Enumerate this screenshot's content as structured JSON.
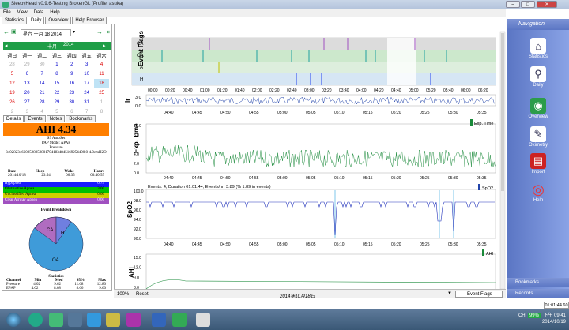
{
  "window": {
    "title": "SleepyHead v0.9.6-Testing BrokenGL (Profile: asuka)"
  },
  "menu": [
    "File",
    "View",
    "Data",
    "Help"
  ],
  "main_tabs": [
    "Statistics",
    "Daily",
    "Overview",
    "Help Browser"
  ],
  "date_nav": {
    "date": "星六 十月 18 2014"
  },
  "calendar": {
    "month": "十月",
    "year": "2014",
    "weekdays": [
      "週日",
      "週一",
      "週二",
      "週三",
      "週四",
      "週五",
      "週六"
    ],
    "weeks": [
      [
        "28",
        "29",
        "30",
        "1",
        "2",
        "3",
        "4"
      ],
      [
        "5",
        "6",
        "7",
        "8",
        "9",
        "10",
        "11"
      ],
      [
        "12",
        "13",
        "14",
        "15",
        "16",
        "17",
        "18"
      ],
      [
        "19",
        "20",
        "21",
        "22",
        "23",
        "24",
        "25"
      ],
      [
        "26",
        "27",
        "28",
        "29",
        "30",
        "31",
        "1"
      ],
      [
        "2",
        "3",
        "4",
        "5",
        "6",
        "7",
        "8"
      ]
    ]
  },
  "detail_tabs": [
    "Details",
    "Events",
    "Notes",
    "Bookmarks"
  ],
  "ahi": {
    "label": "AHI 4.34"
  },
  "machine": {
    "name": "S9 AutoSet",
    "mode": "PAP Mode: APAP",
    "pressure_label": "Pressure",
    "serial": "3402823466085288598017041834845169254400.0-4.0cmH2O"
  },
  "summary": {
    "headers": [
      "Date",
      "Sleep",
      "Wake",
      "Hours"
    ],
    "values": [
      "2014/10/18",
      "23:54",
      "06:35",
      "06:40:55"
    ]
  },
  "events": [
    {
      "name": "Hypopnea",
      "value": "0.75",
      "color": "#1a1aff"
    },
    {
      "name": "Obstructive Apnea",
      "value": "3.00",
      "color": "#00c000"
    },
    {
      "name": "Unclassified Apnea",
      "value": "0.60",
      "color": "#d0d000"
    },
    {
      "name": "Clear Airway Apnea",
      "value": "0.00",
      "color": "#a050c0"
    }
  ],
  "breakdown": {
    "title": "Event Breakdown",
    "labels": [
      "CA",
      "H",
      "OA"
    ]
  },
  "stats": {
    "title": "Statistics",
    "headers": [
      "Channel",
      "Min",
      "Med",
      "95%",
      "Max"
    ],
    "rows": [
      [
        "Pressure",
        "4.02",
        "9.62",
        "11.68",
        "12.80"
      ],
      [
        "EPAP",
        "4.02",
        "8.68",
        "8.66",
        "9.60"
      ]
    ]
  },
  "graphs": {
    "event_flags": {
      "ylabel": "Event Flags",
      "rows": [
        "CA",
        "OA",
        "A",
        "H"
      ],
      "times": [
        "00:00",
        "00:20",
        "00:40",
        "01:00",
        "01:20",
        "01:40",
        "02:00",
        "02:20",
        "02:40",
        "03:00",
        "03:20",
        "03:40",
        "04:00",
        "04:20",
        "04:40",
        "05:00",
        "05:20",
        "05:40",
        "06:00",
        "06:20"
      ]
    },
    "insp": {
      "ylabel": "Ir",
      "ticks": [
        "3.0",
        "0.0"
      ]
    },
    "time_ticks": [
      "04:40",
      "04:45",
      "04:50",
      "04:55",
      "05:00",
      "05:05",
      "05:10",
      "05:15",
      "05:20",
      "05:25",
      "05:30",
      "05:35"
    ],
    "exp_time": {
      "ylabel": "Exp. Time",
      "ticks": [
        "10.0",
        "8.0",
        "6.0",
        "4.0",
        "2.0",
        "0.0"
      ],
      "legend": "Exp. Time"
    },
    "spo2": {
      "ylabel": "SpO2",
      "ticks": [
        "100.0",
        "98.0",
        "96.0",
        "94.0",
        "92.0",
        "90.0"
      ],
      "info": "Events: 4, Duration 01:01:44, Events/hr: 3.89 (% 1.89 in events)",
      "legend": "SpO2"
    },
    "ahi": {
      "ylabel": "AHI",
      "ticks": [
        "15.0",
        "12.0",
        "9.0",
        "8.0"
      ],
      "legend": "AHI"
    }
  },
  "bottom": {
    "zoom": "100%",
    "reset": "Reset",
    "date": "2014年10月18日",
    "dropdown": "Event Flags"
  },
  "nav": {
    "title": "Navigation",
    "items": [
      "Statistics",
      "Daily",
      "Overview",
      "Oximetry",
      "Import",
      "Help"
    ],
    "bookmarks": "Bookmarks",
    "records": "Records"
  },
  "clock_field": "01:01:44.60",
  "tray": {
    "lang": "CH",
    "battery": "99%",
    "time": "下午 09:41",
    "date": "2014/10/19"
  }
}
